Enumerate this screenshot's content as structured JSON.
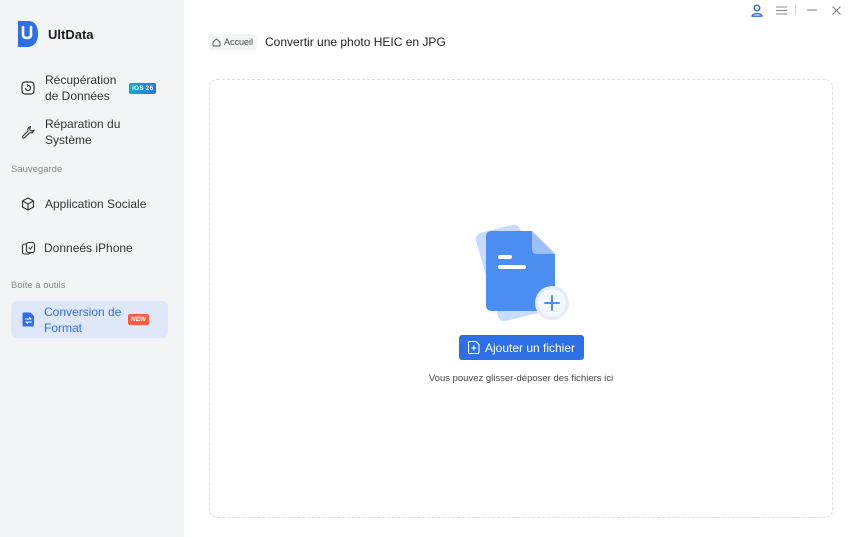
{
  "app": {
    "name": "UltData",
    "brand_color": "#2f6fe6"
  },
  "sidebar": {
    "items": [
      {
        "label": "Récupération de Données",
        "icon": "recovery-icon",
        "badge": "iOS 26"
      },
      {
        "label": "Réparation du Système",
        "icon": "wrench-icon"
      },
      {
        "label": "Application Sociale",
        "icon": "cube-icon"
      },
      {
        "label": "Donneés iPhone",
        "icon": "phone-data-icon"
      },
      {
        "label": "Conversion de Format",
        "icon": "convert-file-icon",
        "badge": "NEW",
        "active": true
      }
    ],
    "sections": {
      "backup": "Sauvegarde",
      "tools": "Boite à outils"
    }
  },
  "breadcrumb": {
    "home": "Accueil",
    "title": "Convertir une photo HEIC en JPG"
  },
  "dropzone": {
    "button_label": "Ajouter un fichier",
    "hint": "Vous pouvez glisser-déposer des fichiers ici"
  }
}
